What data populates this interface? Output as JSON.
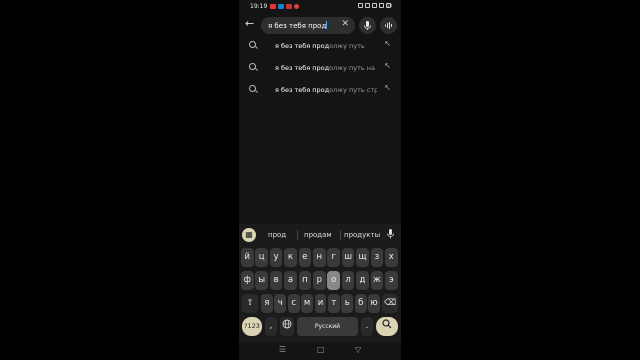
{
  "status": {
    "time": "19:19",
    "battery": "53"
  },
  "search": {
    "query": "я без тебя прод"
  },
  "suggestions": [
    {
      "match": "я без тебя прод",
      "rest": "олжу путь"
    },
    {
      "match": "я без тебя прод",
      "rest": "олжу путь на г..."
    },
    {
      "match": "я без тебя прод",
      "rest": "олжу путь стр..."
    }
  ],
  "keyboard": {
    "suggestions": [
      "прод",
      "продам",
      "продукты"
    ],
    "row1": [
      "й",
      "ц",
      "у",
      "к",
      "е",
      "н",
      "г",
      "ш",
      "щ",
      "з",
      "х"
    ],
    "row2": [
      "ф",
      "ы",
      "в",
      "а",
      "п",
      "р",
      "о",
      "л",
      "д",
      "ж",
      "э"
    ],
    "row3": [
      "я",
      "ч",
      "с",
      "м",
      "и",
      "т",
      "ь",
      "б",
      "ю"
    ],
    "symbols_label": "?123",
    "space_label": "Русский",
    "comma": ",",
    "period": ".",
    "highlight": {
      "top_popup": "о"
    }
  },
  "colors": {
    "accent": "#d9d4b3",
    "bg": "#141414",
    "key": "#3a3a3a",
    "caret": "#4fa3ff"
  }
}
